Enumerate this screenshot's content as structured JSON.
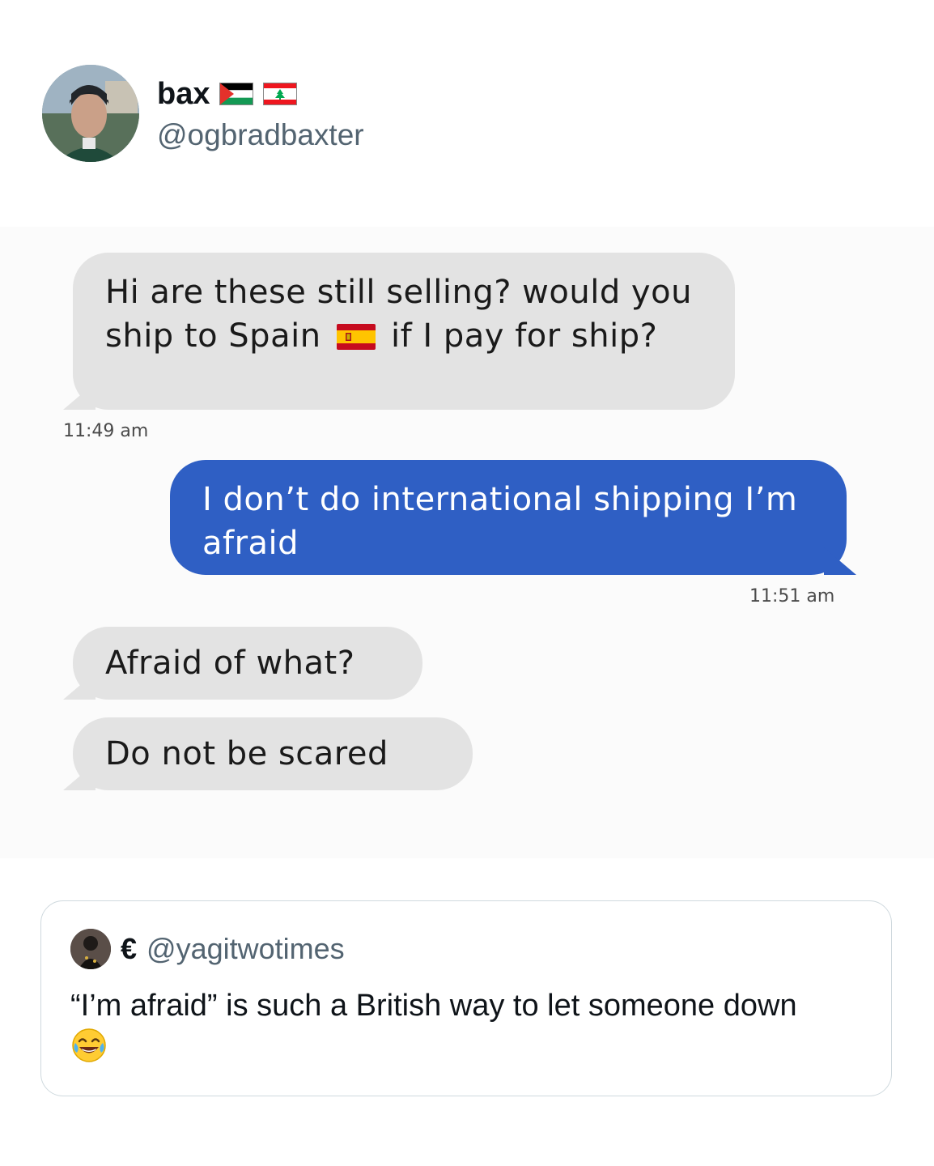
{
  "post": {
    "author_name": "bax",
    "author_handle": "@ogbradbaxter",
    "author_flags": [
      "palestine-flag-icon",
      "lebanon-flag-icon"
    ]
  },
  "conversation": {
    "messages": [
      {
        "direction": "incoming",
        "text_before_flag": "Hi are these still selling? would you ship to Spain",
        "flag": "spain-flag-icon",
        "text_after_flag": "if I pay for ship?",
        "timestamp": "11:49 am"
      },
      {
        "direction": "outgoing",
        "text": "I don’t do international shipping I’m afraid",
        "timestamp": "11:51 am"
      },
      {
        "direction": "incoming",
        "text": "Afraid of what?"
      },
      {
        "direction": "incoming",
        "text": "Do not be scared"
      }
    ],
    "colors": {
      "incoming_bubble": "#e3e3e3",
      "outgoing_bubble": "#2f5fc4"
    }
  },
  "quote": {
    "name": "€",
    "handle": "@yagitwotimes",
    "text": "“I’m afraid” is such a British way to let someone down",
    "emoji": "face-with-tears-of-joy-icon"
  }
}
